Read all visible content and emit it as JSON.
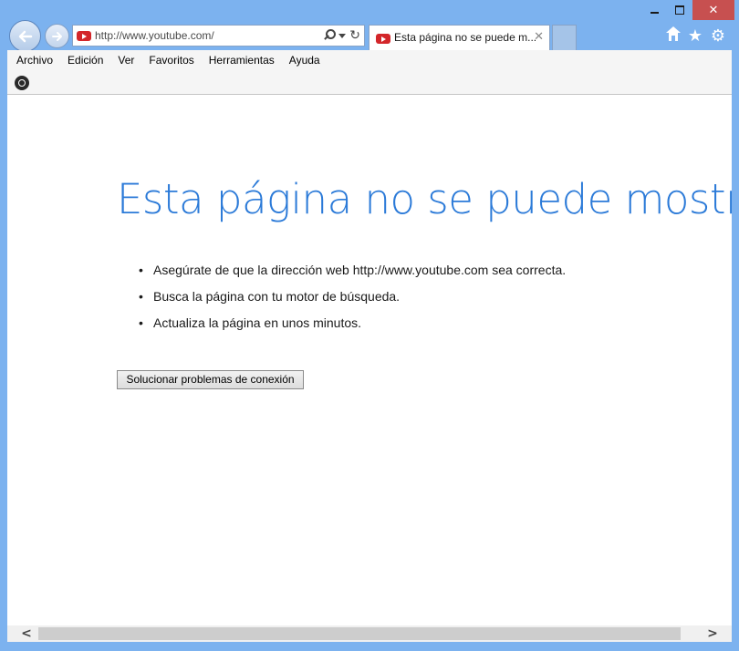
{
  "browser": {
    "address": {
      "url": "http://www.youtube.com/"
    },
    "tab": {
      "title": "Esta página no se puede m...",
      "close": "✕"
    },
    "window": {
      "close": "✕"
    },
    "right_icons": {
      "star": "★",
      "gear": "⚙"
    },
    "refresh_glyph": "↻",
    "back_glyph": "←",
    "forward_glyph": "→"
  },
  "menu": {
    "items": [
      "Archivo",
      "Edición",
      "Ver",
      "Favoritos",
      "Herramientas",
      "Ayuda"
    ]
  },
  "page": {
    "title": "Esta página no se puede mostrar",
    "tips": [
      "Asegúrate de que la dirección web http://www.youtube.com sea correcta.",
      "Busca la página con tu motor de búsqueda.",
      "Actualiza la página en unos minutos."
    ],
    "fix_button": "Solucionar problemas de conexión"
  },
  "scrollbar": {
    "left": "<",
    "right": ">"
  },
  "colors": {
    "accent": "#2b7ad8",
    "frame": "#7cb2ef",
    "close": "#c75050",
    "youtube": "#d3262a"
  },
  "icons": [
    "back-arrow-icon",
    "forward-arrow-icon",
    "youtube-icon",
    "search-icon",
    "dropdown-icon",
    "refresh-icon",
    "home-icon",
    "star-icon",
    "gear-icon",
    "command-bar-icon"
  ]
}
